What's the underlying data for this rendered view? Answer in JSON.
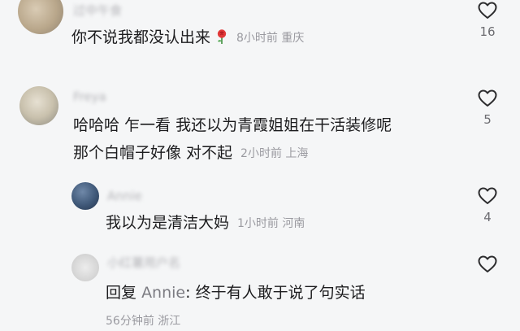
{
  "colors": {
    "background": "#f5f6f7",
    "text": "#1c1c1e",
    "meta": "#9a9aa0",
    "like_count": "#6b6b70"
  },
  "comments": [
    {
      "username": "过中午食",
      "text": "你不说我都没认出来",
      "emoji": "rose-icon",
      "time": "8小时前",
      "location": "重庆",
      "likes": "16"
    },
    {
      "username": "Freya",
      "text_line1": "哈哈哈 乍一看 我还以为青霞姐姐在干活装修呢",
      "text_line2": "那个白帽子好像 对不起",
      "time": "2小时前",
      "location": "上海",
      "likes": "5"
    }
  ],
  "replies": [
    {
      "username": "Annie",
      "text": "我以为是清洁大妈",
      "time": "1小时前",
      "location": "河南",
      "likes": "4"
    },
    {
      "username": "小红薯用户名",
      "reply_prefix": "回复",
      "reply_to": "Annie",
      "text": ": 终于有人敢于说了句实话",
      "time": "56分钟前",
      "location": "浙江",
      "likes": ""
    }
  ]
}
